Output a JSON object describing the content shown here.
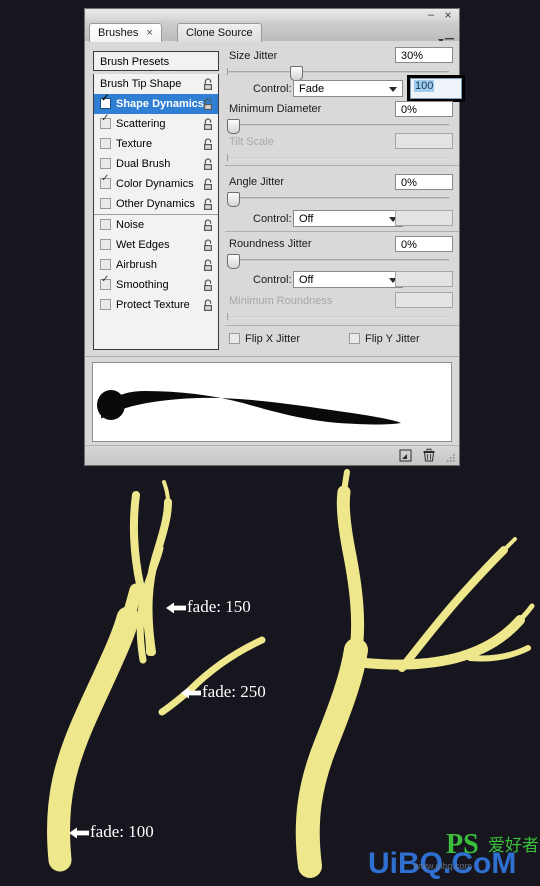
{
  "window": {
    "minimize_label": "–",
    "close_label": "×",
    "menu_icon": "panel-menu-icon"
  },
  "tabs": [
    {
      "label": "Brushes",
      "close": "×",
      "active": true
    },
    {
      "label": "Clone Source",
      "close": "",
      "active": false
    }
  ],
  "presets_button": {
    "label": "Brush Presets"
  },
  "option_list": [
    {
      "label": "Brush Tip Shape",
      "checkbox": false,
      "checked": false,
      "selected": false,
      "lock": true
    },
    {
      "label": "Shape Dynamics",
      "checkbox": true,
      "checked": true,
      "selected": true,
      "lock": true
    },
    {
      "label": "Scattering",
      "checkbox": true,
      "checked": true,
      "selected": false,
      "lock": true
    },
    {
      "label": "Texture",
      "checkbox": true,
      "checked": false,
      "selected": false,
      "lock": true
    },
    {
      "label": "Dual Brush",
      "checkbox": true,
      "checked": false,
      "selected": false,
      "lock": true
    },
    {
      "label": "Color Dynamics",
      "checkbox": true,
      "checked": true,
      "selected": false,
      "lock": true
    },
    {
      "label": "Other Dynamics",
      "checkbox": true,
      "checked": false,
      "selected": false,
      "lock": true
    },
    {
      "label": "Noise",
      "checkbox": true,
      "checked": false,
      "selected": false,
      "lock": true
    },
    {
      "label": "Wet Edges",
      "checkbox": true,
      "checked": false,
      "selected": false,
      "lock": true
    },
    {
      "label": "Airbrush",
      "checkbox": true,
      "checked": false,
      "selected": false,
      "lock": true
    },
    {
      "label": "Smoothing",
      "checkbox": true,
      "checked": true,
      "selected": false,
      "lock": true
    },
    {
      "label": "Protect Texture",
      "checkbox": true,
      "checked": false,
      "selected": false,
      "lock": true
    }
  ],
  "controls": {
    "size_jitter": {
      "label": "Size Jitter",
      "value": "30%",
      "slider_percent": 30
    },
    "size_control": {
      "label": "Control:",
      "value": "Fade",
      "fade_value": "100",
      "fade_focused": true
    },
    "minimum_diameter": {
      "label": "Minimum Diameter",
      "value": "0%",
      "slider_percent": 0
    },
    "tilt_scale": {
      "label": "Tilt Scale",
      "value": "",
      "disabled": true,
      "slider_percent": 0
    },
    "angle_jitter": {
      "label": "Angle Jitter",
      "value": "0%",
      "slider_percent": 0
    },
    "angle_control": {
      "label": "Control:",
      "value": "Off",
      "extra_value": ""
    },
    "roundness_jitter": {
      "label": "Roundness Jitter",
      "value": "0%",
      "slider_percent": 0
    },
    "roundness_control": {
      "label": "Control:",
      "value": "Off",
      "extra_value": ""
    },
    "minimum_roundness": {
      "label": "Minimum Roundness",
      "value": "",
      "disabled": true,
      "slider_percent": 0
    },
    "flip_x": {
      "label": "Flip X Jitter",
      "checked": false
    },
    "flip_y": {
      "label": "Flip Y Jitter",
      "checked": false
    }
  },
  "preview": {
    "name": "brush-stroke-preview"
  },
  "toolbar": {
    "new_brush_icon": "new-brush-icon",
    "delete_brush_icon": "trash-icon"
  },
  "annotations": [
    {
      "text": "fade: 150",
      "arrow": "←"
    },
    {
      "text": "fade: 250",
      "arrow": "←"
    },
    {
      "text": "fade: 100",
      "arrow": "←"
    }
  ],
  "watermark": {
    "main": "UiBQ.CoM",
    "top": "PS",
    "top_cn": "爱好者",
    "sub": "www.uibq.com",
    "main_color": "#2f6fd0",
    "top_color": "#3bbf3b"
  },
  "theme": {
    "canvas_bg": "#17161f",
    "branch_fill": "#efe78c",
    "branch_edge": "#dfd36a",
    "panel_bg": "#d9d9d9",
    "selection_blue": "#2f7fd4",
    "stroke_black": "#0a0a0a"
  }
}
